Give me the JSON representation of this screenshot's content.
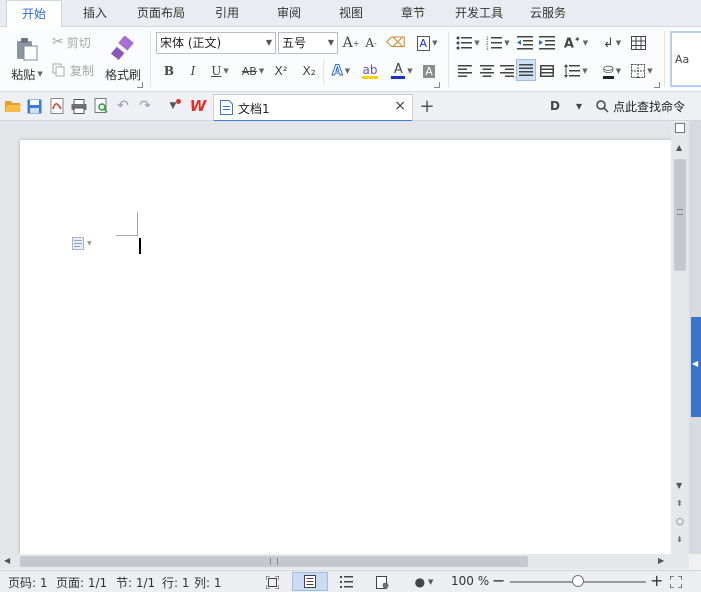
{
  "menu": {
    "tabs": [
      "开始",
      "插入",
      "页面布局",
      "引用",
      "审阅",
      "视图",
      "章节",
      "开发工具",
      "云服务"
    ],
    "active": "开始"
  },
  "ribbon": {
    "paste_label": "粘贴",
    "cut_label": "剪切",
    "copy_label": "复制",
    "format_painter_label": "格式刷",
    "font_name": "宋体 (正文)",
    "font_size": "五号",
    "bold": "B",
    "italic": "I",
    "underline": "U",
    "strikethrough": "AB",
    "superscript": "X²",
    "subscript": "X₂",
    "font_color_letter": "A",
    "style_preview": "Aa"
  },
  "quickbar": {
    "doc_tab_title": "文档1",
    "search_command_label": "点此查找命令"
  },
  "statusbar": {
    "page_number": "页码: 1",
    "pages": "页面: 1/1",
    "section": "节: 1/1",
    "row": "行: 1",
    "column": "列: 1",
    "zoom": "100 %"
  },
  "colors": {
    "accent": "#2a6bd4",
    "wps_red": "#e0302a",
    "font_color_bar": "#1a2fd0",
    "highlight_bar": "#f2d200",
    "side_blue": "#3a74c7"
  }
}
